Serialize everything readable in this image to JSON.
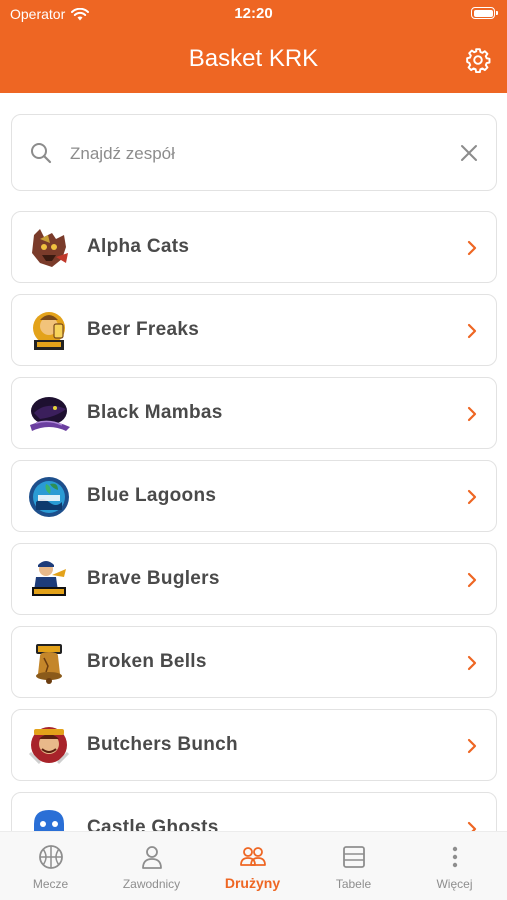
{
  "status": {
    "carrier": "Operator",
    "time": "12:20"
  },
  "header": {
    "title": "Basket KRK"
  },
  "search": {
    "placeholder": "Znajdź zespół",
    "value": ""
  },
  "teams": [
    {
      "name": "Alpha Cats",
      "logo": "alpha-cats-logo"
    },
    {
      "name": "Beer Freaks",
      "logo": "beer-freaks-logo"
    },
    {
      "name": "Black Mambas",
      "logo": "black-mambas-logo"
    },
    {
      "name": "Blue Lagoons",
      "logo": "blue-lagoons-logo"
    },
    {
      "name": "Brave Buglers",
      "logo": "brave-buglers-logo"
    },
    {
      "name": "Broken Bells",
      "logo": "broken-bells-logo"
    },
    {
      "name": "Butchers Bunch",
      "logo": "butchers-bunch-logo"
    },
    {
      "name": "Castle Ghosts",
      "logo": "castle-ghosts-logo"
    }
  ],
  "tabs": [
    {
      "label": "Mecze",
      "icon": "basketball-icon",
      "active": false
    },
    {
      "label": "Zawodnicy",
      "icon": "person-icon",
      "active": false
    },
    {
      "label": "Drużyny",
      "icon": "people-icon",
      "active": true
    },
    {
      "label": "Tabele",
      "icon": "table-icon",
      "active": false
    },
    {
      "label": "Więcej",
      "icon": "more-vertical-icon",
      "active": false
    }
  ],
  "colors": {
    "accent": "#ee6623",
    "text": "#4a4a4a",
    "inactive": "#8e8e8e"
  }
}
